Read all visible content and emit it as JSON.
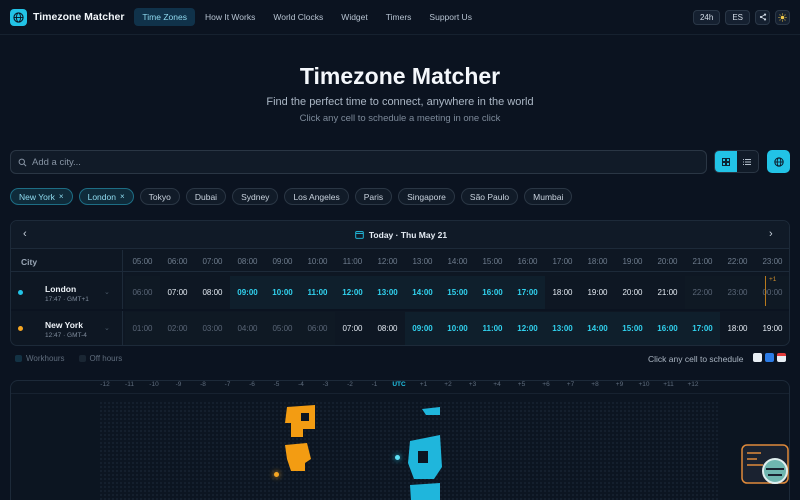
{
  "brand": "Timezone Matcher",
  "nav": [
    {
      "label": "Time Zones",
      "active": true
    },
    {
      "label": "How It Works",
      "active": false
    },
    {
      "label": "World Clocks",
      "active": false
    },
    {
      "label": "Widget",
      "active": false
    },
    {
      "label": "Timers",
      "active": false
    },
    {
      "label": "Support Us",
      "active": false
    }
  ],
  "nav_right": {
    "format": "24h",
    "language": "ES"
  },
  "hero": {
    "title": "Timezone Matcher",
    "subtitle": "Find the perfect time to connect, anywhere in the world",
    "hint": "Click any cell to schedule a meeting in one click"
  },
  "search": {
    "placeholder": "Add a city...",
    "value": ""
  },
  "chips": [
    {
      "label": "New York",
      "selected": true
    },
    {
      "label": "London",
      "selected": true
    },
    {
      "label": "Tokyo",
      "selected": false
    },
    {
      "label": "Dubai",
      "selected": false
    },
    {
      "label": "Sydney",
      "selected": false
    },
    {
      "label": "Los Angeles",
      "selected": false
    },
    {
      "label": "Paris",
      "selected": false
    },
    {
      "label": "Singapore",
      "selected": false
    },
    {
      "label": "São Paulo",
      "selected": false
    },
    {
      "label": "Mumbai",
      "selected": false
    }
  ],
  "timeline": {
    "date": "Today · Thu May 21",
    "city_header": "City",
    "hours": [
      "05:00",
      "06:00",
      "07:00",
      "08:00",
      "09:00",
      "10:00",
      "11:00",
      "12:00",
      "13:00",
      "14:00",
      "15:00",
      "16:00",
      "17:00",
      "18:00",
      "19:00",
      "20:00",
      "21:00",
      "22:00",
      "23:00"
    ],
    "next_day": "+1",
    "rows": [
      {
        "city": "London",
        "meta": "17:47 · GMT+1",
        "color": "#22c3e6",
        "cells": [
          {
            "t": "06:00",
            "s": "off"
          },
          {
            "t": "07:00",
            "s": "day"
          },
          {
            "t": "08:00",
            "s": "day"
          },
          {
            "t": "09:00",
            "s": "work"
          },
          {
            "t": "10:00",
            "s": "work"
          },
          {
            "t": "11:00",
            "s": "work"
          },
          {
            "t": "12:00",
            "s": "work"
          },
          {
            "t": "13:00",
            "s": "work"
          },
          {
            "t": "14:00",
            "s": "work"
          },
          {
            "t": "15:00",
            "s": "work"
          },
          {
            "t": "16:00",
            "s": "work"
          },
          {
            "t": "17:00",
            "s": "work"
          },
          {
            "t": "18:00",
            "s": "day"
          },
          {
            "t": "19:00",
            "s": "day"
          },
          {
            "t": "20:00",
            "s": "day"
          },
          {
            "t": "21:00",
            "s": "day"
          },
          {
            "t": "22:00",
            "s": "off"
          },
          {
            "t": "23:00",
            "s": "off"
          },
          {
            "t": "00:00",
            "s": "off"
          }
        ]
      },
      {
        "city": "New York",
        "meta": "12:47 · GMT-4",
        "color": "#f5a623",
        "cells": [
          {
            "t": "01:00",
            "s": "off"
          },
          {
            "t": "02:00",
            "s": "off"
          },
          {
            "t": "03:00",
            "s": "off"
          },
          {
            "t": "04:00",
            "s": "off"
          },
          {
            "t": "05:00",
            "s": "off"
          },
          {
            "t": "06:00",
            "s": "off"
          },
          {
            "t": "07:00",
            "s": "day"
          },
          {
            "t": "08:00",
            "s": "day"
          },
          {
            "t": "09:00",
            "s": "work"
          },
          {
            "t": "10:00",
            "s": "work"
          },
          {
            "t": "11:00",
            "s": "work"
          },
          {
            "t": "12:00",
            "s": "work"
          },
          {
            "t": "13:00",
            "s": "work"
          },
          {
            "t": "14:00",
            "s": "work"
          },
          {
            "t": "15:00",
            "s": "work"
          },
          {
            "t": "16:00",
            "s": "work"
          },
          {
            "t": "17:00",
            "s": "work"
          },
          {
            "t": "18:00",
            "s": "day"
          },
          {
            "t": "19:00",
            "s": "day"
          }
        ]
      }
    ]
  },
  "legend": {
    "work": "Workhours",
    "off": "Off hours",
    "schedule": "Click any cell to schedule"
  },
  "map": {
    "offsets": [
      "-12",
      "-11",
      "-10",
      "-9",
      "-8",
      "-7",
      "-6",
      "-5",
      "-4",
      "-3",
      "-2",
      "-1",
      "UTC",
      "+1",
      "+2",
      "+3",
      "+4",
      "+5",
      "+6",
      "+7",
      "+8",
      "+9",
      "+10",
      "+11",
      "+12"
    ],
    "zone_colors": {
      "new_york": "#f39c12",
      "london": "#1fb6dc"
    }
  },
  "colors": {
    "accent": "#22c3e6",
    "ny": "#f5a623",
    "bg": "#0b1320"
  }
}
